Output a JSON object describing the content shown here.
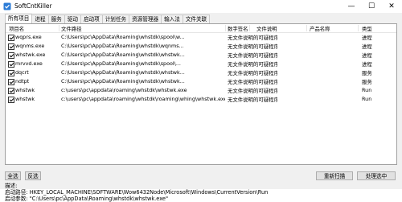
{
  "window": {
    "title": "SoftCntKiller",
    "controls": {
      "minimize": "—",
      "maximize": "☐",
      "close": "✕"
    }
  },
  "icons": {
    "app": "app-icon"
  },
  "tabs": [
    {
      "label": "所有项目",
      "active": true
    },
    {
      "label": "进程",
      "active": false
    },
    {
      "label": "服务",
      "active": false
    },
    {
      "label": "驱动",
      "active": false
    },
    {
      "label": "启动项",
      "active": false
    },
    {
      "label": "计划任务",
      "active": false
    },
    {
      "label": "资源管理器",
      "active": false
    },
    {
      "label": "输入法",
      "active": false
    },
    {
      "label": "文件关联",
      "active": false
    }
  ],
  "table": {
    "columns": [
      "项目名",
      "文件路径",
      "数字签名",
      "文件说明",
      "产品名称",
      "类型"
    ],
    "rows": [
      {
        "checked": true,
        "name": "wqprs.exe",
        "path": "C:\\Users\\pc\\AppData\\Roaming\\whstdk\\spool\\w...",
        "signature": "无文件说明的可疑程序",
        "description": "",
        "product": "",
        "type": "进程"
      },
      {
        "checked": true,
        "name": "wqnms.exe",
        "path": "C:\\Users\\pc\\AppData\\Roaming\\whstdk\\wqnms...",
        "signature": "无文件说明的可疑程序",
        "description": "",
        "product": "",
        "type": "进程"
      },
      {
        "checked": true,
        "name": "whstwk.exe",
        "path": "C:\\Users\\pc\\AppData\\Roaming\\whstdk\\whstwk...",
        "signature": "无文件说明的可疑程序",
        "description": "",
        "product": "",
        "type": "进程"
      },
      {
        "checked": true,
        "name": "mrvvd.exe",
        "path": "C:\\Users\\pc\\AppData\\Roaming\\whstdk\\spool\\...",
        "signature": "无文件说明的可疑程序",
        "description": "",
        "product": "",
        "type": "进程"
      },
      {
        "checked": true,
        "name": "dqcrt",
        "path": "C:\\Users\\pc\\AppData\\Roaming\\whstdk\\whstwk...",
        "signature": "无文件说明的可疑程序",
        "description": "",
        "product": "",
        "type": "服务"
      },
      {
        "checked": true,
        "name": "ndtpt",
        "path": "C:\\Users\\pc\\AppData\\Roaming\\whstdk\\whstwk...",
        "signature": "无文件说明的可疑程序",
        "description": "",
        "product": "",
        "type": "服务"
      },
      {
        "checked": true,
        "name": "whstwk",
        "path": "c:\\users\\pc\\appdata\\roaming\\whstdk\\whstwk.exe",
        "signature": "无文件说明的可疑程序",
        "description": "",
        "product": "",
        "type": "Run"
      },
      {
        "checked": true,
        "name": "whstwk",
        "path": "c:\\users\\pc\\appdata\\roaming\\whstdk\\roaming\\whing\\whstwk.exe",
        "signature": "无文件说明的可疑程序",
        "description": "",
        "product": "",
        "type": "Run"
      }
    ]
  },
  "buttons": {
    "select_all": "全选",
    "invert": "反选",
    "rescan": "重新扫描",
    "process_selected": "处理选中"
  },
  "info": {
    "description": "描述:",
    "location": "启动路径:      HKEY_LOCAL_MACHINE\\SOFTWARE\\Wow6432Node\\Microsoft\\Windows\\CurrentVersion\\Run",
    "arguments": "启动参数:   \"C:\\Users\\pc\\AppData\\Roaming\\whstdk\\whstwk.exe\""
  }
}
